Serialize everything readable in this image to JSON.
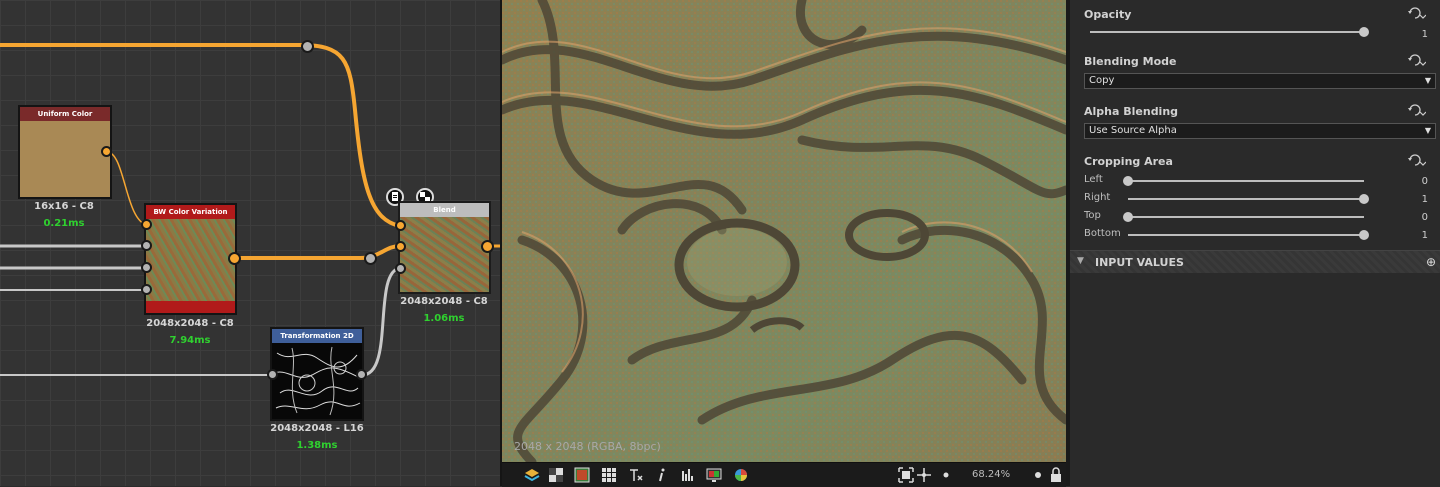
{
  "graph": {
    "nodes": {
      "uniform_color": {
        "title": "Uniform Color",
        "info": "16x16 - C8",
        "time": "0.21ms"
      },
      "bw_color_variation": {
        "title": "BW Color Variation",
        "info": "2048x2048 - C8",
        "time": "7.94ms"
      },
      "blend": {
        "title": "Blend",
        "info": "2048x2048 - C8",
        "time": "1.06ms"
      },
      "transformation_2d": {
        "title": "Transformation 2D",
        "info": "2048x2048 - L16",
        "time": "1.38ms"
      }
    }
  },
  "view2d": {
    "image_info": "2048 x 2048 (RGBA, 8bpc)",
    "zoom": "68.24%",
    "toolbar_icons": [
      "layers-icon",
      "checker-icon",
      "color-swatch-icon",
      "grid-icon",
      "tiling-icon",
      "info-icon",
      "histogram-icon",
      "display-icon",
      "color-wheel-icon",
      "fit-icon",
      "pan-icon",
      "zoom-out-icon",
      "zoom-in-icon",
      "lock-icon"
    ]
  },
  "properties": {
    "opacity": {
      "title": "Opacity",
      "value": "1",
      "fraction": 1.0
    },
    "blending_mode": {
      "title": "Blending Mode",
      "selected": "Copy"
    },
    "alpha_blending": {
      "title": "Alpha Blending",
      "selected": "Use Source Alpha"
    },
    "cropping_area": {
      "title": "Cropping Area",
      "rows": [
        {
          "label": "Left",
          "value": "0",
          "fraction": 0.0
        },
        {
          "label": "Right",
          "value": "1",
          "fraction": 1.0
        },
        {
          "label": "Top",
          "value": "0",
          "fraction": 0.0
        },
        {
          "label": "Bottom",
          "value": "1",
          "fraction": 1.0
        }
      ]
    },
    "input_values": {
      "title": "INPUT VALUES"
    }
  },
  "colors": {
    "wire_orange": "#f6a632",
    "uniform_header": "#7a2a2a",
    "uniform_fill": "#a98955",
    "bw_header": "#b11a1a",
    "blend_header": "#bdbdbd",
    "transform_header": "#3f5f9a",
    "time_green": "#2fd12f"
  }
}
